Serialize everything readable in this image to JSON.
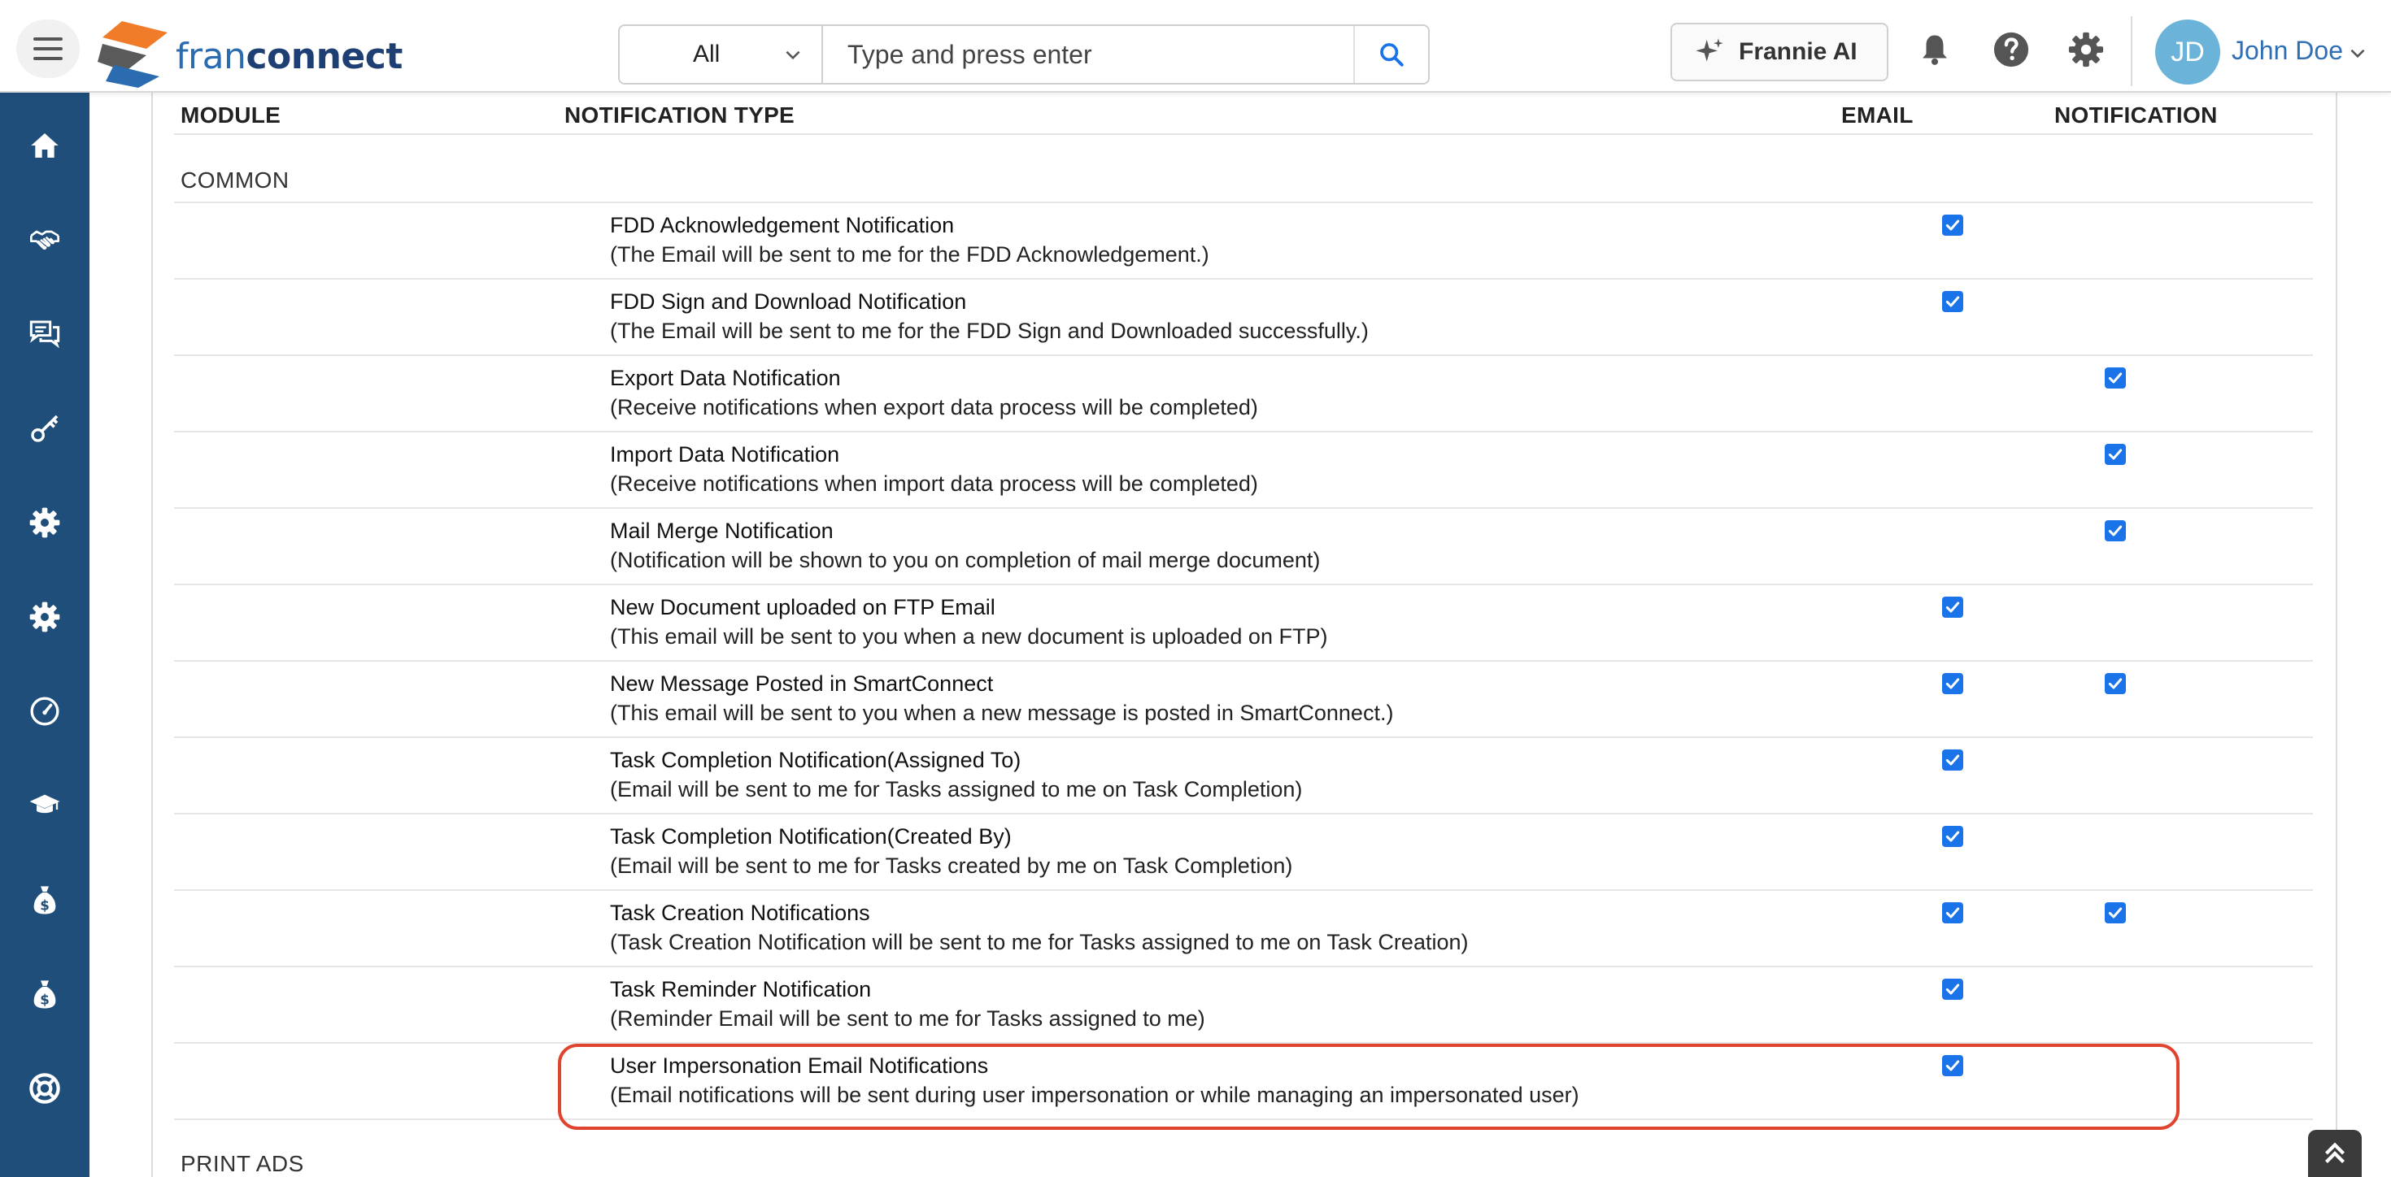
{
  "header": {
    "logo_part1": "fran",
    "logo_part2": "connect",
    "search": {
      "scope_value": "All",
      "placeholder": "Type and press enter"
    },
    "ai_button_label": "Frannie AI",
    "user": {
      "initials": "JD",
      "name": "John Doe"
    }
  },
  "sidebar": {
    "items": [
      {
        "icon": "home-icon"
      },
      {
        "icon": "handshake-icon"
      },
      {
        "icon": "chat-icon"
      },
      {
        "icon": "key-icon"
      },
      {
        "icon": "gear-icon"
      },
      {
        "icon": "gear-icon"
      },
      {
        "icon": "speedometer-icon"
      },
      {
        "icon": "graduation-cap-icon"
      },
      {
        "icon": "money-bag-icon"
      },
      {
        "icon": "money-bag-icon"
      },
      {
        "icon": "lifebuoy-icon"
      }
    ]
  },
  "table": {
    "headers": {
      "module": "MODULE",
      "type": "NOTIFICATION TYPE",
      "email": "EMAIL",
      "notification": "NOTIFICATION"
    },
    "sections": [
      {
        "name": "COMMON",
        "rows": [
          {
            "title": "FDD Acknowledgement Notification",
            "desc": "(The Email will be sent to me for the FDD Acknowledgement.)",
            "email": true,
            "notification": false
          },
          {
            "title": "FDD Sign and Download Notification",
            "desc": "(The Email will be sent to me for the FDD Sign and Downloaded successfully.)",
            "email": true,
            "notification": false
          },
          {
            "title": "Export Data Notification",
            "desc": "(Receive notifications when export data process will be completed)",
            "email": false,
            "notification": true
          },
          {
            "title": "Import Data Notification",
            "desc": "(Receive notifications when import data process will be completed)",
            "email": false,
            "notification": true
          },
          {
            "title": "Mail Merge Notification",
            "desc": "(Notification will be shown to you on completion of mail merge document)",
            "email": false,
            "notification": true
          },
          {
            "title": "New Document uploaded on FTP Email",
            "desc": "(This email will be sent to you when a new document is uploaded on FTP)",
            "email": true,
            "notification": false
          },
          {
            "title": "New Message Posted in SmartConnect",
            "desc": "(This email will be sent to you when a new message is posted in SmartConnect.)",
            "email": true,
            "notification": true
          },
          {
            "title": "Task Completion Notification(Assigned To)",
            "desc": "(Email will be sent to me for Tasks assigned to me on Task Completion)",
            "email": true,
            "notification": false
          },
          {
            "title": "Task Completion Notification(Created By)",
            "desc": "(Email will be sent to me for Tasks created by me on Task Completion)",
            "email": true,
            "notification": false
          },
          {
            "title": "Task Creation Notifications",
            "desc": "(Task Creation Notification will be sent to me for Tasks assigned to me on Task Creation)",
            "email": true,
            "notification": true
          },
          {
            "title": "Task Reminder Notification",
            "desc": "(Reminder Email will be sent to me for Tasks assigned to me)",
            "email": true,
            "notification": false
          },
          {
            "title": "User Impersonation Email Notifications",
            "desc": "(Email notifications will be sent during user impersonation or while managing an impersonated user)",
            "email": true,
            "notification": false
          }
        ]
      },
      {
        "name": "PRINT ADS",
        "rows": []
      }
    ]
  },
  "colors": {
    "sidebar": "#1f4e7b",
    "checkbox": "#1a73e8",
    "highlight": "#e0442e",
    "user_name": "#2e6fb5"
  }
}
